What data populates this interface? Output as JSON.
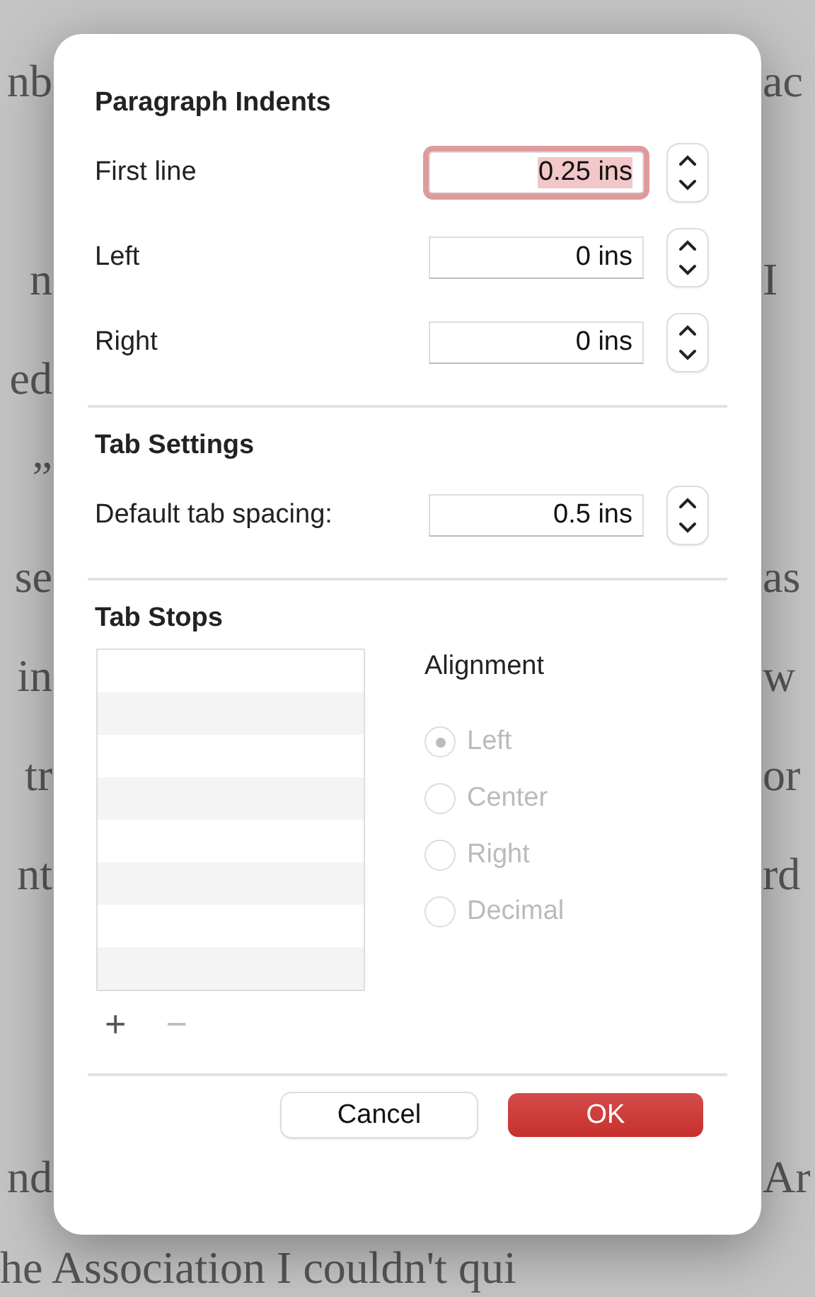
{
  "background_document": {
    "paragraphs": [
      {
        "lines": [
          {
            "left": "nb",
            "right": "ac"
          }
        ]
      },
      {
        "lines": [
          {
            "left": "n",
            "right": "I"
          },
          {
            "left": "ed"
          },
          {
            "left": "”"
          },
          {
            "left": "se",
            "right": "as"
          },
          {
            "left": "in",
            "right": "w"
          },
          {
            "left": "tr",
            "right": "or"
          },
          {
            "left": "nt",
            "right": "rd"
          }
        ]
      },
      {
        "lines": [
          {
            "left": "nd",
            "right": "Ar"
          }
        ]
      }
    ],
    "last_line": "he Association I couldn't qui"
  },
  "dialog": {
    "sections": [
      {
        "title": "Paragraph Indents",
        "fields": [
          {
            "label": "First line",
            "value": "0.25 ins",
            "focused": true
          },
          {
            "label": "Left",
            "value": "0 ins",
            "focused": false
          },
          {
            "label": "Right",
            "value": "0 ins",
            "focused": false
          }
        ]
      },
      {
        "title": "Tab Settings",
        "fields": [
          {
            "label": "Default tab spacing:",
            "value": "0.5 ins",
            "focused": false
          }
        ]
      }
    ],
    "tab_stops": {
      "title": "Tab Stops",
      "alignment_label": "Alignment",
      "alignments": [
        {
          "label": "Left",
          "selected": true,
          "disabled": true
        },
        {
          "label": "Center",
          "selected": false,
          "disabled": true
        },
        {
          "label": "Right",
          "selected": false,
          "disabled": true
        },
        {
          "label": "Decimal",
          "selected": false,
          "disabled": true
        }
      ],
      "add_button": {
        "label": "+",
        "disabled": false
      },
      "remove_button": {
        "label": "−",
        "disabled": true
      }
    },
    "buttons": [
      {
        "label": "Cancel",
        "kind": "secondary"
      },
      {
        "label": "OK",
        "kind": "primary"
      }
    ]
  }
}
